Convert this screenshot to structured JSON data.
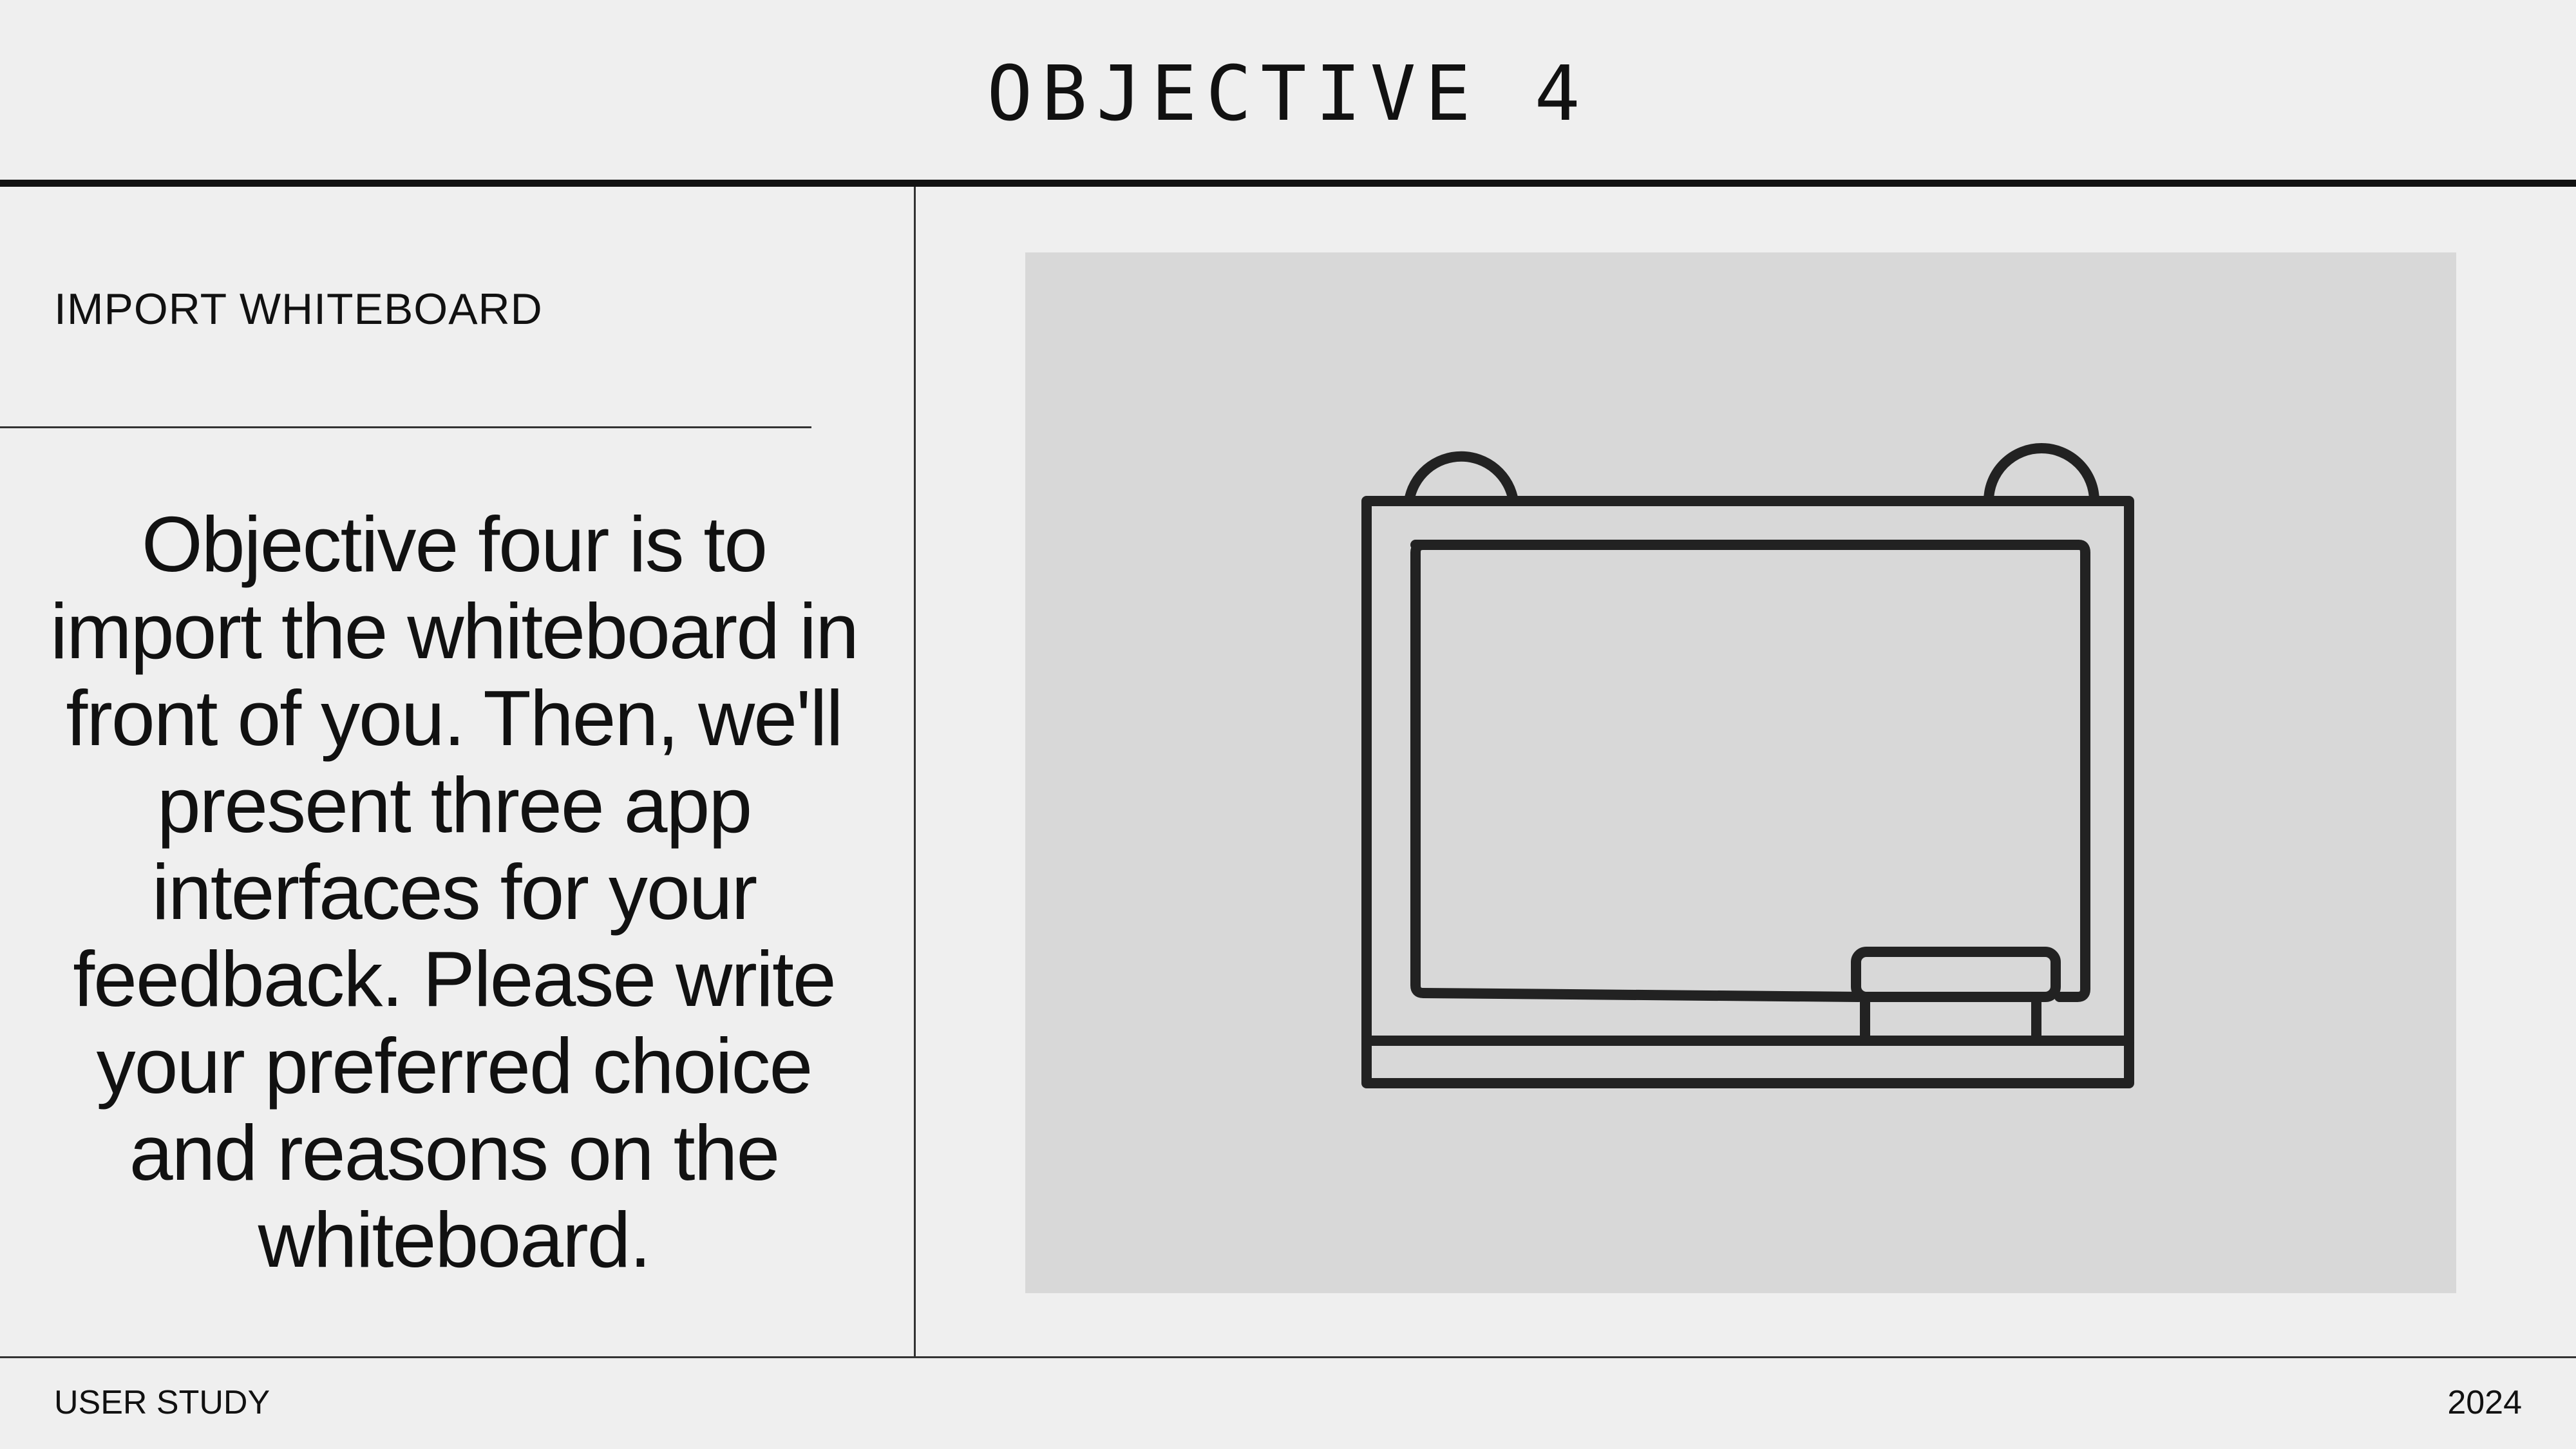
{
  "header": {
    "title": "OBJECTIVE 4"
  },
  "sidebar": {
    "section_label": "IMPORT WHITEBOARD",
    "body": "Objective four is to import the whiteboard in front of you. Then, we'll present three app interfaces for your feedback. Please write your preferred choice and reasons on the whiteboard."
  },
  "illustration": {
    "icon": "whiteboard-icon",
    "background_color": "#d8d8d8",
    "stroke_color": "#222222"
  },
  "footer": {
    "left": "USER STUDY",
    "right": "2024"
  }
}
